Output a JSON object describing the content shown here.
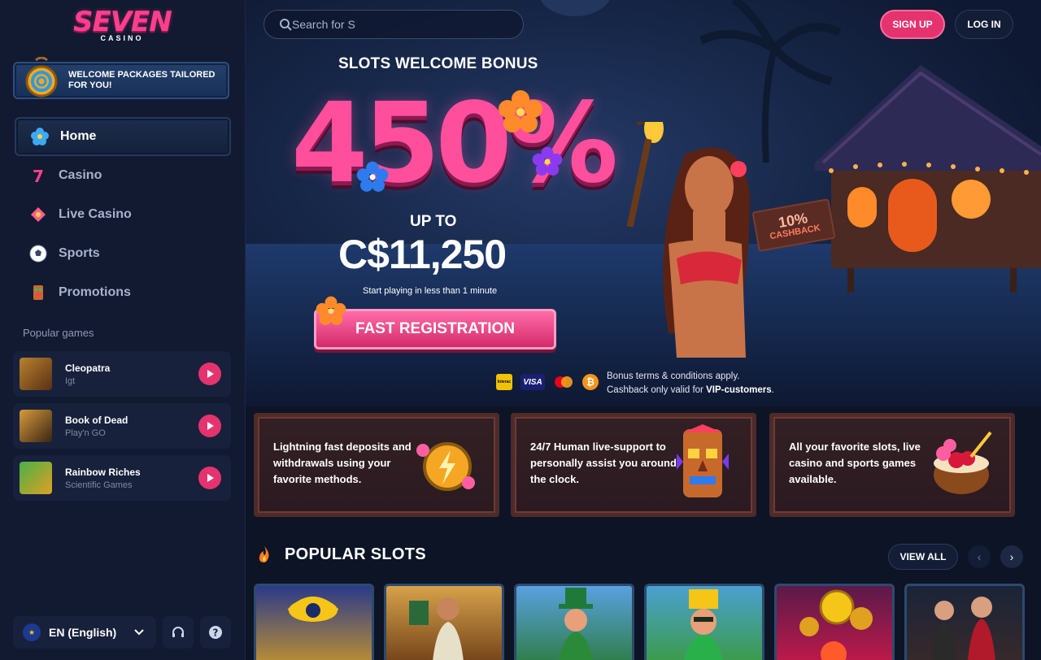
{
  "brand": {
    "logo_main": "SEVEN",
    "logo_sub": "CASINO"
  },
  "welcome_banner": {
    "text": "WELCOME PACKAGES TAILORED FOR YOU!"
  },
  "nav": {
    "items": [
      {
        "label": "Home",
        "icon": "flower-icon",
        "active": true
      },
      {
        "label": "Casino",
        "icon": "seven-icon",
        "active": false
      },
      {
        "label": "Live Casino",
        "icon": "live-diamond-icon",
        "active": false
      },
      {
        "label": "Sports",
        "icon": "soccer-ball-icon",
        "active": false
      },
      {
        "label": "Promotions",
        "icon": "tiki-mask-icon",
        "active": false
      }
    ]
  },
  "popular_games": {
    "label": "Popular games",
    "items": [
      {
        "name": "Cleopatra",
        "provider": "Igt"
      },
      {
        "name": "Book of Dead",
        "provider": "Play'n GO"
      },
      {
        "name": "Rainbow Riches",
        "provider": "Scientific Games"
      }
    ]
  },
  "footer": {
    "language": "EN (English)",
    "support_icon": "headset-icon",
    "help_icon": "question-icon"
  },
  "header": {
    "search_placeholder": "Search for S",
    "signup": "SIGN UP",
    "login": "LOG IN"
  },
  "hero": {
    "title": "SLOTS WELCOME BONUS",
    "percent": "450%",
    "upto": "UP TO",
    "amount": "C$11,250",
    "subtext": "Start playing in less than 1 minute",
    "cta": "FAST REGISTRATION",
    "cashback_value": "10%",
    "cashback_label": "CASHBACK"
  },
  "terms": {
    "line1": "Bonus terms & conditions apply.",
    "line2_prefix": "Cashback only valid for ",
    "line2_bold": "VIP-customers",
    "line2_suffix": "."
  },
  "payments": {
    "interac": "Interac",
    "visa": "VISA",
    "bitcoin": "₿"
  },
  "features": [
    {
      "text": "Lightning fast deposits and withdrawals using your favorite methods.",
      "icon": "lightning-medallion-icon"
    },
    {
      "text": "24/7 Human live-support to personally assist you around the clock.",
      "icon": "tiki-totem-icon"
    },
    {
      "text": "All your favorite slots, live casino and sports games available.",
      "icon": "coconut-cocktail-icon"
    }
  ],
  "popular_slots": {
    "title": "POPULAR SLOTS",
    "view_all": "VIEW ALL",
    "prev": "‹",
    "next": "›"
  },
  "colors": {
    "accent": "#e4336f",
    "sidebar_bg": "#111a31",
    "page_bg": "#0d1426"
  }
}
